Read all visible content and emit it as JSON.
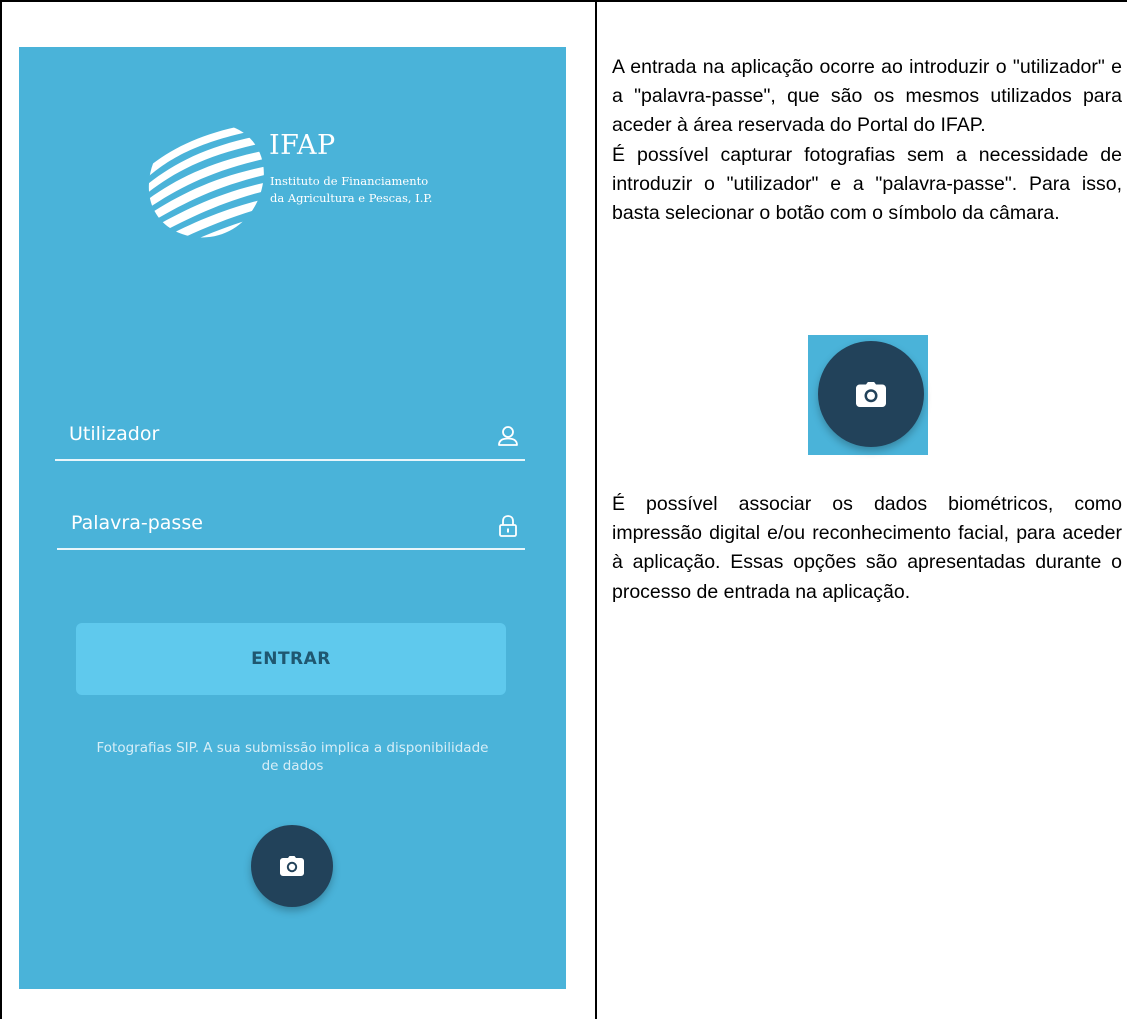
{
  "app": {
    "logo_title": "IFAP",
    "logo_subtitle_line1": "Instituto de Financiamento",
    "logo_subtitle_line2": "da Agricultura e Pescas, I.P.",
    "username_label": "Utilizador",
    "password_label": "Palavra-passe",
    "enter_button_label": "ENTRAR",
    "notice_line1": "Fotografias SIP. A sua submissão implica a disponibilidade",
    "notice_line2": "de dados",
    "colors": {
      "background": "#4ab3d9",
      "button": "#5fc9ed",
      "button_text": "#1f5770",
      "fab": "#22425a"
    },
    "icons": {
      "username": "user-icon",
      "password": "lock-icon",
      "fab": "camera-icon"
    }
  },
  "instructions": {
    "paragraph1": "A entrada na aplicação ocorre ao introduzir o \"utilizador\" e a \"palavra-passe\", que são os mesmos utilizados para aceder à área reservada do Portal do IFAP.",
    "paragraph2": "É possível capturar fotografias sem a necessidade de introduzir o \"utilizador\" e a \"palavra-passe\". Para isso, basta selecionar o botão com o símbolo da câmara.",
    "paragraph3": "É possível associar os dados biométricos, como impressão digital e/ou reconhecimento facial, para aceder à aplicação. Essas opções são apresentadas durante o processo de entrada na aplicação."
  }
}
